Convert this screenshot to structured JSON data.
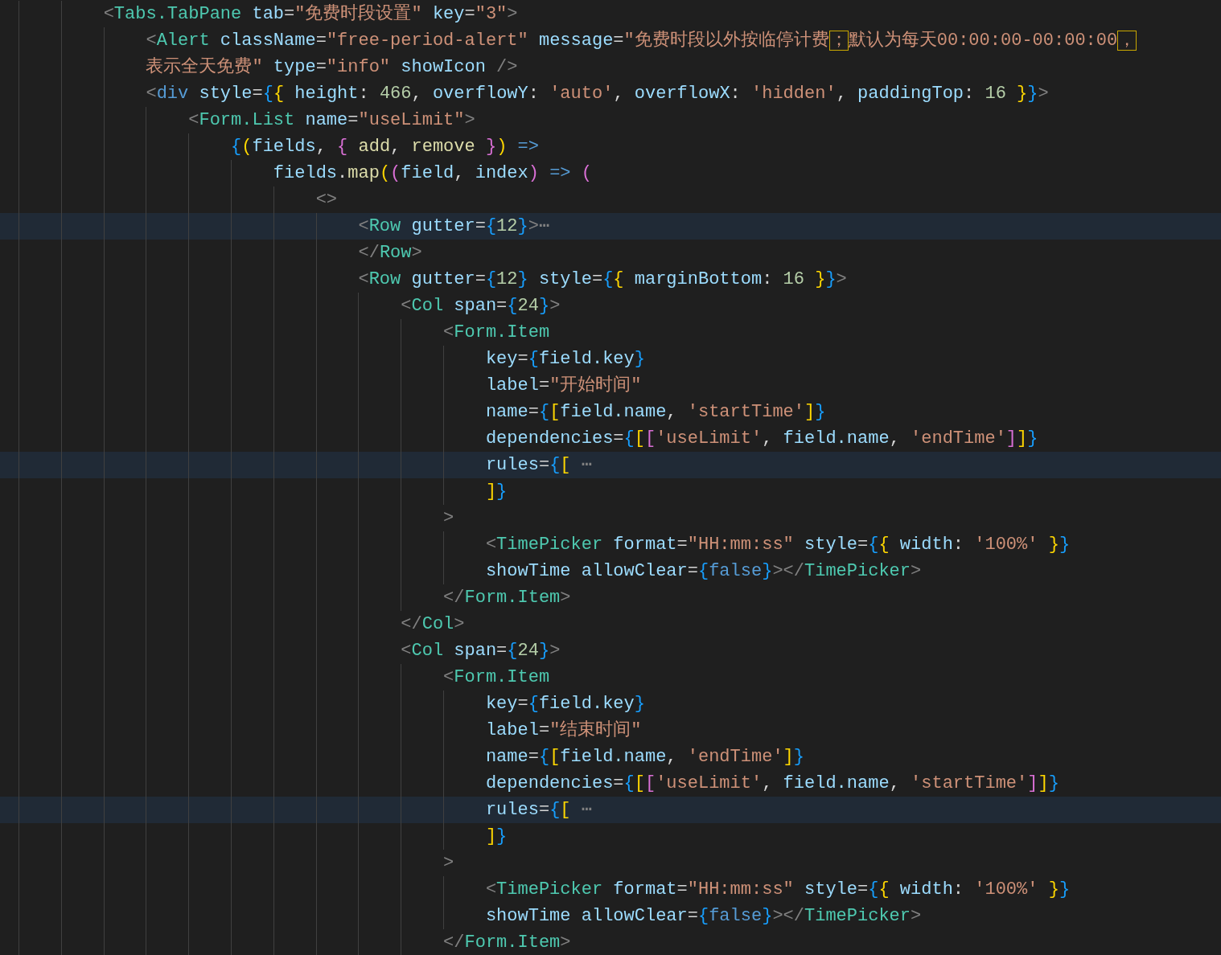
{
  "editor": {
    "lines": [
      {
        "highlighted": false,
        "tokens": [
          {
            "kind": "punct",
            "text": "        <"
          },
          {
            "kind": "tag",
            "text": "Tabs.TabPane "
          },
          {
            "kind": "attr",
            "text": "tab"
          },
          {
            "kind": "plain",
            "text": "="
          },
          {
            "kind": "string",
            "text": "\"免费时段设置\" "
          },
          {
            "kind": "attr",
            "text": "key"
          },
          {
            "kind": "plain",
            "text": "="
          },
          {
            "kind": "string",
            "text": "\"3\""
          },
          {
            "kind": "punct",
            "text": ">"
          }
        ]
      },
      {
        "highlighted": false,
        "tokens": [
          {
            "kind": "punct",
            "text": "            <"
          },
          {
            "kind": "tag",
            "text": "Alert "
          },
          {
            "kind": "attr",
            "text": "className"
          },
          {
            "kind": "plain",
            "text": "="
          },
          {
            "kind": "string",
            "text": "\"free-period-alert\" "
          },
          {
            "kind": "attr",
            "text": "message"
          },
          {
            "kind": "plain",
            "text": "="
          },
          {
            "kind": "string",
            "text": "\"免费时段以外按临停计费"
          },
          {
            "kind": "warn",
            "text": "；"
          },
          {
            "kind": "string",
            "text": "默认为每天00:00:00-00:00:00"
          },
          {
            "kind": "warn",
            "text": "，"
          }
        ]
      },
      {
        "highlighted": false,
        "tokens": [
          {
            "kind": "string",
            "text": "            表示全天免费\" "
          },
          {
            "kind": "attr",
            "text": "type"
          },
          {
            "kind": "plain",
            "text": "="
          },
          {
            "kind": "string",
            "text": "\"info\" "
          },
          {
            "kind": "attr",
            "text": "showIcon "
          },
          {
            "kind": "punct",
            "text": "/>"
          }
        ]
      },
      {
        "highlighted": false,
        "tokens": [
          {
            "kind": "punct",
            "text": "            <"
          },
          {
            "kind": "keyword",
            "text": "div "
          },
          {
            "kind": "attr",
            "text": "style"
          },
          {
            "kind": "plain",
            "text": "="
          },
          {
            "kind": "blue",
            "text": "{"
          },
          {
            "kind": "gold",
            "text": "{ "
          },
          {
            "kind": "attr",
            "text": "height"
          },
          {
            "kind": "plain",
            "text": ": "
          },
          {
            "kind": "number",
            "text": "466"
          },
          {
            "kind": "plain",
            "text": ", "
          },
          {
            "kind": "attr",
            "text": "overflowY"
          },
          {
            "kind": "plain",
            "text": ": "
          },
          {
            "kind": "string",
            "text": "'auto'"
          },
          {
            "kind": "plain",
            "text": ", "
          },
          {
            "kind": "attr",
            "text": "overflowX"
          },
          {
            "kind": "plain",
            "text": ": "
          },
          {
            "kind": "string",
            "text": "'hidden'"
          },
          {
            "kind": "plain",
            "text": ", "
          },
          {
            "kind": "attr",
            "text": "paddingTop"
          },
          {
            "kind": "plain",
            "text": ": "
          },
          {
            "kind": "number",
            "text": "16 "
          },
          {
            "kind": "gold",
            "text": "}"
          },
          {
            "kind": "blue",
            "text": "}"
          },
          {
            "kind": "punct",
            "text": ">"
          }
        ]
      },
      {
        "highlighted": false,
        "tokens": [
          {
            "kind": "punct",
            "text": "                <"
          },
          {
            "kind": "tag",
            "text": "Form.List "
          },
          {
            "kind": "attr",
            "text": "name"
          },
          {
            "kind": "plain",
            "text": "="
          },
          {
            "kind": "string",
            "text": "\"useLimit\""
          },
          {
            "kind": "punct",
            "text": ">"
          }
        ]
      },
      {
        "highlighted": false,
        "tokens": [
          {
            "kind": "blue",
            "text": "                    {"
          },
          {
            "kind": "gold",
            "text": "("
          },
          {
            "kind": "attr",
            "text": "fields"
          },
          {
            "kind": "plain",
            "text": ", "
          },
          {
            "kind": "purple",
            "text": "{ "
          },
          {
            "kind": "function",
            "text": "add"
          },
          {
            "kind": "plain",
            "text": ", "
          },
          {
            "kind": "function",
            "text": "remove "
          },
          {
            "kind": "purple",
            "text": "}"
          },
          {
            "kind": "gold",
            "text": ") "
          },
          {
            "kind": "keyword",
            "text": "=>"
          }
        ]
      },
      {
        "highlighted": false,
        "tokens": [
          {
            "kind": "attr",
            "text": "                        fields"
          },
          {
            "kind": "plain",
            "text": "."
          },
          {
            "kind": "function",
            "text": "map"
          },
          {
            "kind": "gold",
            "text": "("
          },
          {
            "kind": "purple",
            "text": "("
          },
          {
            "kind": "attr",
            "text": "field"
          },
          {
            "kind": "plain",
            "text": ", "
          },
          {
            "kind": "attr",
            "text": "index"
          },
          {
            "kind": "purple",
            "text": ") "
          },
          {
            "kind": "keyword",
            "text": "=> "
          },
          {
            "kind": "purple",
            "text": "("
          }
        ]
      },
      {
        "highlighted": false,
        "tokens": [
          {
            "kind": "punct",
            "text": "                            <>"
          }
        ]
      },
      {
        "highlighted": true,
        "tokens": [
          {
            "kind": "punct",
            "text": "                                <"
          },
          {
            "kind": "tag",
            "text": "Row "
          },
          {
            "kind": "attr",
            "text": "gutter"
          },
          {
            "kind": "plain",
            "text": "="
          },
          {
            "kind": "blue",
            "text": "{"
          },
          {
            "kind": "number",
            "text": "12"
          },
          {
            "kind": "blue",
            "text": "}"
          },
          {
            "kind": "punct",
            "text": ">"
          },
          {
            "kind": "fold",
            "text": "⋯"
          }
        ]
      },
      {
        "highlighted": false,
        "tokens": [
          {
            "kind": "punct",
            "text": "                                </"
          },
          {
            "kind": "tag",
            "text": "Row"
          },
          {
            "kind": "punct",
            "text": ">"
          }
        ]
      },
      {
        "highlighted": false,
        "tokens": [
          {
            "kind": "punct",
            "text": "                                <"
          },
          {
            "kind": "tag",
            "text": "Row "
          },
          {
            "kind": "attr",
            "text": "gutter"
          },
          {
            "kind": "plain",
            "text": "="
          },
          {
            "kind": "blue",
            "text": "{"
          },
          {
            "kind": "number",
            "text": "12"
          },
          {
            "kind": "blue",
            "text": "} "
          },
          {
            "kind": "attr",
            "text": "style"
          },
          {
            "kind": "plain",
            "text": "="
          },
          {
            "kind": "blue",
            "text": "{"
          },
          {
            "kind": "gold",
            "text": "{ "
          },
          {
            "kind": "attr",
            "text": "marginBottom"
          },
          {
            "kind": "plain",
            "text": ": "
          },
          {
            "kind": "number",
            "text": "16 "
          },
          {
            "kind": "gold",
            "text": "}"
          },
          {
            "kind": "blue",
            "text": "}"
          },
          {
            "kind": "punct",
            "text": ">"
          }
        ]
      },
      {
        "highlighted": false,
        "tokens": [
          {
            "kind": "punct",
            "text": "                                    <"
          },
          {
            "kind": "tag",
            "text": "Col "
          },
          {
            "kind": "attr",
            "text": "span"
          },
          {
            "kind": "plain",
            "text": "="
          },
          {
            "kind": "blue",
            "text": "{"
          },
          {
            "kind": "number",
            "text": "24"
          },
          {
            "kind": "blue",
            "text": "}"
          },
          {
            "kind": "punct",
            "text": ">"
          }
        ]
      },
      {
        "highlighted": false,
        "tokens": [
          {
            "kind": "punct",
            "text": "                                        <"
          },
          {
            "kind": "tag",
            "text": "Form.Item"
          }
        ]
      },
      {
        "highlighted": false,
        "tokens": [
          {
            "kind": "attr",
            "text": "                                            key"
          },
          {
            "kind": "plain",
            "text": "="
          },
          {
            "kind": "blue",
            "text": "{"
          },
          {
            "kind": "attr",
            "text": "field.key"
          },
          {
            "kind": "blue",
            "text": "}"
          }
        ]
      },
      {
        "highlighted": false,
        "tokens": [
          {
            "kind": "attr",
            "text": "                                            label"
          },
          {
            "kind": "plain",
            "text": "="
          },
          {
            "kind": "string",
            "text": "\"开始时间\""
          }
        ]
      },
      {
        "highlighted": false,
        "tokens": [
          {
            "kind": "attr",
            "text": "                                            name"
          },
          {
            "kind": "plain",
            "text": "="
          },
          {
            "kind": "blue",
            "text": "{"
          },
          {
            "kind": "gold",
            "text": "["
          },
          {
            "kind": "attr",
            "text": "field.name"
          },
          {
            "kind": "plain",
            "text": ", "
          },
          {
            "kind": "string",
            "text": "'startTime'"
          },
          {
            "kind": "gold",
            "text": "]"
          },
          {
            "kind": "blue",
            "text": "}"
          }
        ]
      },
      {
        "highlighted": false,
        "tokens": [
          {
            "kind": "attr",
            "text": "                                            dependencies"
          },
          {
            "kind": "plain",
            "text": "="
          },
          {
            "kind": "blue",
            "text": "{"
          },
          {
            "kind": "gold",
            "text": "["
          },
          {
            "kind": "purple",
            "text": "["
          },
          {
            "kind": "string",
            "text": "'useLimit'"
          },
          {
            "kind": "plain",
            "text": ", "
          },
          {
            "kind": "attr",
            "text": "field.name"
          },
          {
            "kind": "plain",
            "text": ", "
          },
          {
            "kind": "string",
            "text": "'endTime'"
          },
          {
            "kind": "purple",
            "text": "]"
          },
          {
            "kind": "gold",
            "text": "]"
          },
          {
            "kind": "blue",
            "text": "}"
          }
        ]
      },
      {
        "highlighted": true,
        "tokens": [
          {
            "kind": "attr",
            "text": "                                            rules"
          },
          {
            "kind": "plain",
            "text": "="
          },
          {
            "kind": "blue",
            "text": "{"
          },
          {
            "kind": "gold",
            "text": "[ "
          },
          {
            "kind": "fold",
            "text": "⋯"
          }
        ]
      },
      {
        "highlighted": false,
        "tokens": [
          {
            "kind": "gold",
            "text": "                                            ]"
          },
          {
            "kind": "blue",
            "text": "}"
          }
        ]
      },
      {
        "highlighted": false,
        "tokens": [
          {
            "kind": "punct",
            "text": "                                        >"
          }
        ]
      },
      {
        "highlighted": false,
        "tokens": [
          {
            "kind": "punct",
            "text": "                                            <"
          },
          {
            "kind": "tag",
            "text": "TimePicker "
          },
          {
            "kind": "attr",
            "text": "format"
          },
          {
            "kind": "plain",
            "text": "="
          },
          {
            "kind": "string",
            "text": "\"HH:mm:ss\" "
          },
          {
            "kind": "attr",
            "text": "style"
          },
          {
            "kind": "plain",
            "text": "="
          },
          {
            "kind": "blue",
            "text": "{"
          },
          {
            "kind": "gold",
            "text": "{ "
          },
          {
            "kind": "attr",
            "text": "width"
          },
          {
            "kind": "plain",
            "text": ": "
          },
          {
            "kind": "string",
            "text": "'100%' "
          },
          {
            "kind": "gold",
            "text": "}"
          },
          {
            "kind": "blue",
            "text": "}"
          }
        ]
      },
      {
        "highlighted": false,
        "tokens": [
          {
            "kind": "attr",
            "text": "                                            showTime "
          },
          {
            "kind": "attr",
            "text": "allowClear"
          },
          {
            "kind": "plain",
            "text": "="
          },
          {
            "kind": "blue",
            "text": "{"
          },
          {
            "kind": "keyword",
            "text": "false"
          },
          {
            "kind": "blue",
            "text": "}"
          },
          {
            "kind": "punct",
            "text": "></"
          },
          {
            "kind": "tag",
            "text": "TimePicker"
          },
          {
            "kind": "punct",
            "text": ">"
          }
        ]
      },
      {
        "highlighted": false,
        "tokens": [
          {
            "kind": "punct",
            "text": "                                        </"
          },
          {
            "kind": "tag",
            "text": "Form.Item"
          },
          {
            "kind": "punct",
            "text": ">"
          }
        ]
      },
      {
        "highlighted": false,
        "tokens": [
          {
            "kind": "punct",
            "text": "                                    </"
          },
          {
            "kind": "tag",
            "text": "Col"
          },
          {
            "kind": "punct",
            "text": ">"
          }
        ]
      },
      {
        "highlighted": false,
        "tokens": [
          {
            "kind": "punct",
            "text": "                                    <"
          },
          {
            "kind": "tag",
            "text": "Col "
          },
          {
            "kind": "attr",
            "text": "span"
          },
          {
            "kind": "plain",
            "text": "="
          },
          {
            "kind": "blue",
            "text": "{"
          },
          {
            "kind": "number",
            "text": "24"
          },
          {
            "kind": "blue",
            "text": "}"
          },
          {
            "kind": "punct",
            "text": ">"
          }
        ]
      },
      {
        "highlighted": false,
        "tokens": [
          {
            "kind": "punct",
            "text": "                                        <"
          },
          {
            "kind": "tag",
            "text": "Form.Item"
          }
        ]
      },
      {
        "highlighted": false,
        "tokens": [
          {
            "kind": "attr",
            "text": "                                            key"
          },
          {
            "kind": "plain",
            "text": "="
          },
          {
            "kind": "blue",
            "text": "{"
          },
          {
            "kind": "attr",
            "text": "field.key"
          },
          {
            "kind": "blue",
            "text": "}"
          }
        ]
      },
      {
        "highlighted": false,
        "tokens": [
          {
            "kind": "attr",
            "text": "                                            label"
          },
          {
            "kind": "plain",
            "text": "="
          },
          {
            "kind": "string",
            "text": "\"结束时间\""
          }
        ]
      },
      {
        "highlighted": false,
        "tokens": [
          {
            "kind": "attr",
            "text": "                                            name"
          },
          {
            "kind": "plain",
            "text": "="
          },
          {
            "kind": "blue",
            "text": "{"
          },
          {
            "kind": "gold",
            "text": "["
          },
          {
            "kind": "attr",
            "text": "field.name"
          },
          {
            "kind": "plain",
            "text": ", "
          },
          {
            "kind": "string",
            "text": "'endTime'"
          },
          {
            "kind": "gold",
            "text": "]"
          },
          {
            "kind": "blue",
            "text": "}"
          }
        ]
      },
      {
        "highlighted": false,
        "tokens": [
          {
            "kind": "attr",
            "text": "                                            dependencies"
          },
          {
            "kind": "plain",
            "text": "="
          },
          {
            "kind": "blue",
            "text": "{"
          },
          {
            "kind": "gold",
            "text": "["
          },
          {
            "kind": "purple",
            "text": "["
          },
          {
            "kind": "string",
            "text": "'useLimit'"
          },
          {
            "kind": "plain",
            "text": ", "
          },
          {
            "kind": "attr",
            "text": "field.name"
          },
          {
            "kind": "plain",
            "text": ", "
          },
          {
            "kind": "string",
            "text": "'startTime'"
          },
          {
            "kind": "purple",
            "text": "]"
          },
          {
            "kind": "gold",
            "text": "]"
          },
          {
            "kind": "blue",
            "text": "}"
          }
        ]
      },
      {
        "highlighted": true,
        "tokens": [
          {
            "kind": "attr",
            "text": "                                            rules"
          },
          {
            "kind": "plain",
            "text": "="
          },
          {
            "kind": "blue",
            "text": "{"
          },
          {
            "kind": "gold",
            "text": "[ "
          },
          {
            "kind": "fold",
            "text": "⋯"
          }
        ]
      },
      {
        "highlighted": false,
        "tokens": [
          {
            "kind": "gold",
            "text": "                                            ]"
          },
          {
            "kind": "blue",
            "text": "}"
          }
        ]
      },
      {
        "highlighted": false,
        "tokens": [
          {
            "kind": "punct",
            "text": "                                        >"
          }
        ]
      },
      {
        "highlighted": false,
        "tokens": [
          {
            "kind": "punct",
            "text": "                                            <"
          },
          {
            "kind": "tag",
            "text": "TimePicker "
          },
          {
            "kind": "attr",
            "text": "format"
          },
          {
            "kind": "plain",
            "text": "="
          },
          {
            "kind": "string",
            "text": "\"HH:mm:ss\" "
          },
          {
            "kind": "attr",
            "text": "style"
          },
          {
            "kind": "plain",
            "text": "="
          },
          {
            "kind": "blue",
            "text": "{"
          },
          {
            "kind": "gold",
            "text": "{ "
          },
          {
            "kind": "attr",
            "text": "width"
          },
          {
            "kind": "plain",
            "text": ": "
          },
          {
            "kind": "string",
            "text": "'100%' "
          },
          {
            "kind": "gold",
            "text": "}"
          },
          {
            "kind": "blue",
            "text": "}"
          }
        ]
      },
      {
        "highlighted": false,
        "tokens": [
          {
            "kind": "attr",
            "text": "                                            showTime "
          },
          {
            "kind": "attr",
            "text": "allowClear"
          },
          {
            "kind": "plain",
            "text": "="
          },
          {
            "kind": "blue",
            "text": "{"
          },
          {
            "kind": "keyword",
            "text": "false"
          },
          {
            "kind": "blue",
            "text": "}"
          },
          {
            "kind": "punct",
            "text": "></"
          },
          {
            "kind": "tag",
            "text": "TimePicker"
          },
          {
            "kind": "punct",
            "text": ">"
          }
        ]
      },
      {
        "highlighted": false,
        "tokens": [
          {
            "kind": "punct",
            "text": "                                        </"
          },
          {
            "kind": "tag",
            "text": "Form.Item"
          },
          {
            "kind": "punct",
            "text": ">"
          }
        ]
      }
    ]
  }
}
